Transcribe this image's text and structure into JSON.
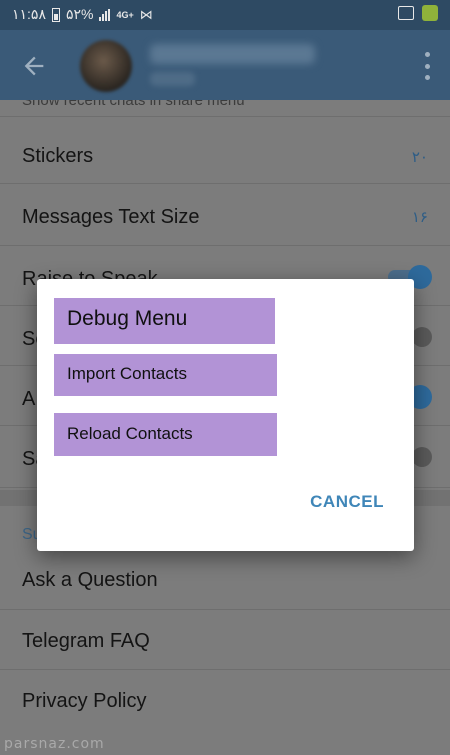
{
  "status_bar": {
    "time": "۱۱:۵۸",
    "battery": "۵۲%",
    "network": "4G+"
  },
  "settings": {
    "cut_off_label": "Show recent chats in share menu",
    "rows": [
      {
        "label": "Stickers",
        "value": "۲۰"
      },
      {
        "label": "Messages Text Size",
        "value": "۱۶"
      },
      {
        "label": "Raise to Speak",
        "toggle": "on"
      },
      {
        "label": "Se",
        "toggle": "off"
      },
      {
        "label": "A",
        "toggle": "on"
      },
      {
        "label": "Sa",
        "toggle": "off"
      }
    ],
    "section_label": "Su",
    "support_rows": [
      {
        "label": "Ask a Question"
      },
      {
        "label": "Telegram FAQ"
      },
      {
        "label": "Privacy Policy"
      }
    ]
  },
  "dialog": {
    "title": "Debug Menu",
    "items": [
      "Import Contacts",
      "Reload Contacts"
    ],
    "cancel_label": "CANCEL",
    "highlight_color": "#b293d6",
    "accent_color": "#3f86b8"
  },
  "watermark": "parsnaz.com",
  "colors": {
    "app_bar": "#3a5a78",
    "link": "#2e5d86"
  }
}
